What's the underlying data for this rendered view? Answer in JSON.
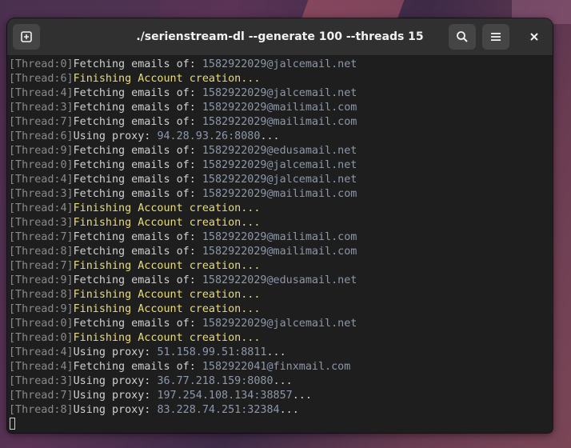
{
  "window": {
    "title": "./serienstream-dl --generate 100 --threads 15",
    "new_tab_icon": "new-tab-icon",
    "search_icon": "search-icon",
    "menu_icon": "hamburger-menu-icon",
    "close_icon": "close-icon"
  },
  "colors": {
    "thread_tag": "#8a8a8a",
    "text": "#d0d0d0",
    "value": "#8c98ab",
    "highlight": "#e9dc7a",
    "background": "#1e1e1e"
  },
  "lines": [
    {
      "tag": "[Thread:0]",
      "text": "Fetching emails of: ",
      "value": "1582922029@jalcemail.net",
      "suffix": "",
      "style": "normal"
    },
    {
      "tag": "[Thread:6]",
      "text": "Finishing Account creation...",
      "value": "",
      "suffix": "",
      "style": "highlight"
    },
    {
      "tag": "[Thread:4]",
      "text": "Fetching emails of: ",
      "value": "1582922029@jalcemail.net",
      "suffix": "",
      "style": "normal"
    },
    {
      "tag": "[Thread:3]",
      "text": "Fetching emails of: ",
      "value": "1582922029@mailimail.com",
      "suffix": "",
      "style": "normal"
    },
    {
      "tag": "[Thread:7]",
      "text": "Fetching emails of: ",
      "value": "1582922029@mailimail.com",
      "suffix": "",
      "style": "normal"
    },
    {
      "tag": "[Thread:6]",
      "text": "Using proxy: ",
      "value": "94.28.93.26:8080",
      "suffix": "...",
      "style": "normal"
    },
    {
      "tag": "[Thread:9]",
      "text": "Fetching emails of: ",
      "value": "1582922029@edusamail.net",
      "suffix": "",
      "style": "normal"
    },
    {
      "tag": "[Thread:0]",
      "text": "Fetching emails of: ",
      "value": "1582922029@jalcemail.net",
      "suffix": "",
      "style": "normal"
    },
    {
      "tag": "[Thread:4]",
      "text": "Fetching emails of: ",
      "value": "1582922029@jalcemail.net",
      "suffix": "",
      "style": "normal"
    },
    {
      "tag": "[Thread:3]",
      "text": "Fetching emails of: ",
      "value": "1582922029@mailimail.com",
      "suffix": "",
      "style": "normal"
    },
    {
      "tag": "[Thread:4]",
      "text": "Finishing Account creation...",
      "value": "",
      "suffix": "",
      "style": "highlight"
    },
    {
      "tag": "[Thread:3]",
      "text": "Finishing Account creation...",
      "value": "",
      "suffix": "",
      "style": "highlight"
    },
    {
      "tag": "[Thread:7]",
      "text": "Fetching emails of: ",
      "value": "1582922029@mailimail.com",
      "suffix": "",
      "style": "normal"
    },
    {
      "tag": "[Thread:8]",
      "text": "Fetching emails of: ",
      "value": "1582922029@mailimail.com",
      "suffix": "",
      "style": "normal"
    },
    {
      "tag": "[Thread:7]",
      "text": "Finishing Account creation...",
      "value": "",
      "suffix": "",
      "style": "highlight"
    },
    {
      "tag": "[Thread:9]",
      "text": "Fetching emails of: ",
      "value": "1582922029@edusamail.net",
      "suffix": "",
      "style": "normal"
    },
    {
      "tag": "[Thread:8]",
      "text": "Finishing Account creation...",
      "value": "",
      "suffix": "",
      "style": "highlight"
    },
    {
      "tag": "[Thread:9]",
      "text": "Finishing Account creation...",
      "value": "",
      "suffix": "",
      "style": "highlight"
    },
    {
      "tag": "[Thread:0]",
      "text": "Fetching emails of: ",
      "value": "1582922029@jalcemail.net",
      "suffix": "",
      "style": "normal"
    },
    {
      "tag": "[Thread:0]",
      "text": "Finishing Account creation...",
      "value": "",
      "suffix": "",
      "style": "highlight"
    },
    {
      "tag": "[Thread:4]",
      "text": "Using proxy: ",
      "value": "51.158.99.51:8811",
      "suffix": "...",
      "style": "normal"
    },
    {
      "tag": "[Thread:4]",
      "text": "Fetching emails of: ",
      "value": "1582922041@finxmail.com",
      "suffix": "",
      "style": "normal"
    },
    {
      "tag": "[Thread:3]",
      "text": "Using proxy: ",
      "value": "36.77.218.159:8080",
      "suffix": "...",
      "style": "normal"
    },
    {
      "tag": "[Thread:7]",
      "text": "Using proxy: ",
      "value": "197.254.108.134:38857",
      "suffix": "...",
      "style": "normal"
    },
    {
      "tag": "[Thread:8]",
      "text": "Using proxy: ",
      "value": "83.228.74.251:32384",
      "suffix": "...",
      "style": "normal"
    }
  ]
}
